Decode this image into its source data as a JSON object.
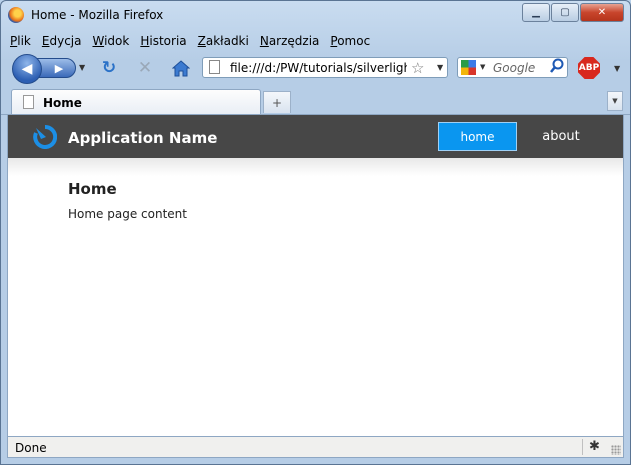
{
  "window": {
    "title": "Home - Mozilla Firefox",
    "buttons": {
      "minimize": "▁",
      "maximize": "▢",
      "close": "✕"
    }
  },
  "menu": {
    "items": [
      "Plik",
      "Edycja",
      "Widok",
      "Historia",
      "Zakładki",
      "Narzędzia",
      "Pomoc"
    ]
  },
  "toolbar": {
    "back_glyph": "◀",
    "forward_glyph": "▶",
    "reload_glyph": "↻",
    "stop_glyph": "✕",
    "address": "file:///d:/PW/tutorials/silverlight/",
    "search_placeholder": "Google",
    "abp_label": "ABP"
  },
  "tabs": [
    {
      "label": "Home",
      "active": true
    }
  ],
  "new_tab_glyph": "+",
  "app": {
    "name": "Application Name",
    "nav": [
      {
        "label": "home",
        "active": true
      },
      {
        "label": "about",
        "active": false
      }
    ],
    "heading": "Home",
    "body": "Home page content",
    "header_color": "#474747",
    "accent_color": "#0a96f0"
  },
  "status": {
    "text": "Done"
  },
  "icons": {
    "browser_logo": "firefox-logo-icon",
    "reload": "reload-icon",
    "stop": "stop-icon",
    "home": "home-icon",
    "bookmark": "star-icon",
    "search_engine": "google-icon",
    "search_go": "magnifier-icon",
    "adblock": "abp-icon",
    "page": "page-icon",
    "app_logo": "app-logo-icon",
    "status_bug": "bug-icon",
    "resize_grip": "resize-grip-icon"
  }
}
